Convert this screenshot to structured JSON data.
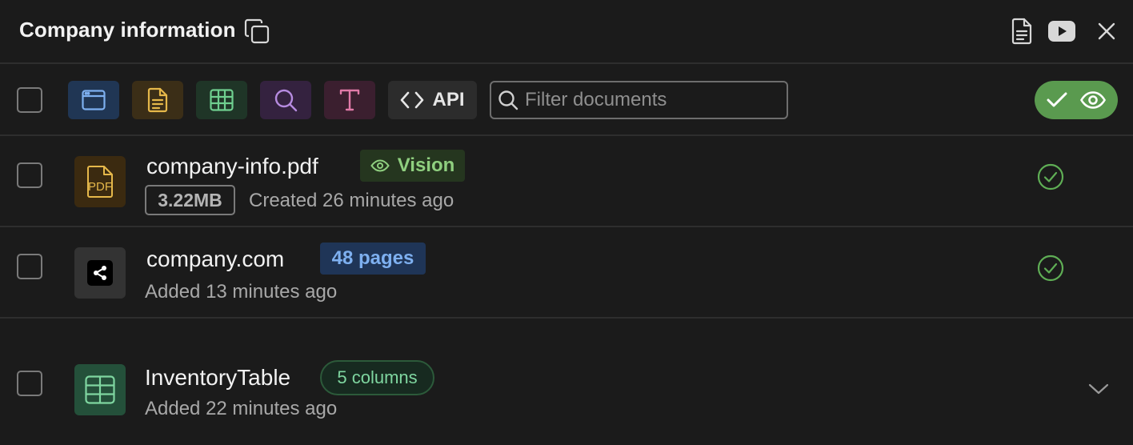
{
  "header": {
    "title": "Company information"
  },
  "toolbar": {
    "api_label": "API",
    "search": {
      "placeholder": "Filter documents",
      "value": ""
    }
  },
  "documents": [
    {
      "name": "company-info.pdf",
      "icon_label": "PDF",
      "badge": "Vision",
      "size": "3.22MB",
      "meta": "Created 26 minutes ago",
      "status": "processed"
    },
    {
      "name": "company.com",
      "badge": "48 pages",
      "meta": "Added 13 minutes ago",
      "status": "processed"
    },
    {
      "name": "InventoryTable",
      "badge": "5 columns",
      "meta": "Added 22 minutes ago",
      "status": "collapsed"
    }
  ],
  "colors": {
    "accent_green": "#5a9a4f",
    "blue_badge": "#7eb0f0",
    "vision_green": "#8fcf7f",
    "pdf_yellow": "#e6b84a"
  }
}
